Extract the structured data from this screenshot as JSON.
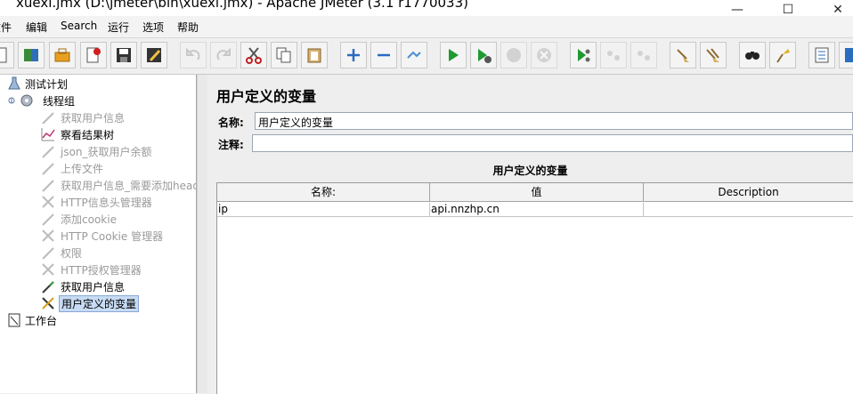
{
  "window": {
    "title": "xuexi.jmx (D:\\jmeter\\bin\\xuexi.jmx) - Apache JMeter (3.1 r1770033)",
    "minimize_glyph": "—",
    "maximize_glyph": "☐",
    "close_glyph": "✕"
  },
  "menu": {
    "items": [
      {
        "label": "文件"
      },
      {
        "label": "编辑"
      },
      {
        "label": "Search"
      },
      {
        "label": "运行"
      },
      {
        "label": "选项"
      },
      {
        "label": "帮助"
      }
    ]
  },
  "toolbar": {
    "buttons": [
      {
        "icon": "new-file-icon"
      },
      {
        "icon": "templates-icon"
      },
      {
        "icon": "open-icon"
      },
      {
        "icon": "close-file-icon"
      },
      {
        "icon": "save-icon"
      },
      {
        "icon": "save-as-icon"
      },
      {
        "icon": "undo-icon",
        "enabled": false
      },
      {
        "icon": "redo-icon",
        "enabled": false
      },
      {
        "icon": "cut-icon"
      },
      {
        "icon": "copy-icon"
      },
      {
        "icon": "paste-icon"
      },
      {
        "icon": "expand-icon"
      },
      {
        "icon": "collapse-icon"
      },
      {
        "icon": "toggle-icon"
      },
      {
        "icon": "start-icon"
      },
      {
        "icon": "start-no-pause-icon"
      },
      {
        "icon": "stop-icon",
        "enabled": false
      },
      {
        "icon": "shutdown-icon",
        "enabled": false
      },
      {
        "icon": "remote-start-icon"
      },
      {
        "icon": "remote-stop-icon",
        "enabled": false
      },
      {
        "icon": "remote-shutdown-icon",
        "enabled": false
      },
      {
        "icon": "clear-icon"
      },
      {
        "icon": "clear-all-icon"
      },
      {
        "icon": "search-icon"
      },
      {
        "icon": "reset-search-icon"
      },
      {
        "icon": "function-helper-icon"
      },
      {
        "icon": "help-icon"
      }
    ]
  },
  "tree": {
    "nodes": [
      {
        "label": "测试计划",
        "icon": "test-plan-icon",
        "level": 0,
        "enabled": true
      },
      {
        "label": "线程组",
        "icon": "thread-group-icon",
        "level": 1,
        "enabled": true
      },
      {
        "label": "获取用户信息",
        "icon": "sampler-icon",
        "level": 2,
        "enabled": false
      },
      {
        "label": "察看结果树",
        "icon": "listener-icon",
        "level": 2,
        "enabled": true
      },
      {
        "label": "json_获取用户余额",
        "icon": "sampler-icon",
        "level": 2,
        "enabled": false
      },
      {
        "label": "上传文件",
        "icon": "sampler-icon",
        "level": 2,
        "enabled": false
      },
      {
        "label": "获取用户信息_需要添加header",
        "icon": "sampler-icon",
        "level": 2,
        "enabled": false
      },
      {
        "label": "HTTP信息头管理器",
        "icon": "config-element-icon",
        "level": 2,
        "enabled": false
      },
      {
        "label": "添加cookie",
        "icon": "sampler-icon",
        "level": 2,
        "enabled": false
      },
      {
        "label": "HTTP Cookie 管理器",
        "icon": "config-element-icon",
        "level": 2,
        "enabled": false
      },
      {
        "label": "权限",
        "icon": "sampler-icon",
        "level": 2,
        "enabled": false
      },
      {
        "label": "HTTP授权管理器",
        "icon": "config-element-icon",
        "level": 2,
        "enabled": false
      },
      {
        "label": "获取用户信息",
        "icon": "sampler-icon",
        "level": 2,
        "enabled": true
      },
      {
        "label": "用户定义的变量",
        "icon": "config-element-icon",
        "level": 2,
        "enabled": true,
        "selected": true
      },
      {
        "label": "工作台",
        "icon": "workbench-icon",
        "level": 0,
        "enabled": true
      }
    ]
  },
  "panel": {
    "title": "用户定义的变量",
    "name_label": "名称:",
    "name_value": "用户定义的变量",
    "comment_label": "注释:",
    "comment_value": "",
    "table_title": "用户定义的变量",
    "columns": [
      "名称:",
      "值",
      "Description"
    ],
    "rows": [
      {
        "name": "ip",
        "value": "api.nnzhp.cn",
        "description": ""
      }
    ]
  }
}
